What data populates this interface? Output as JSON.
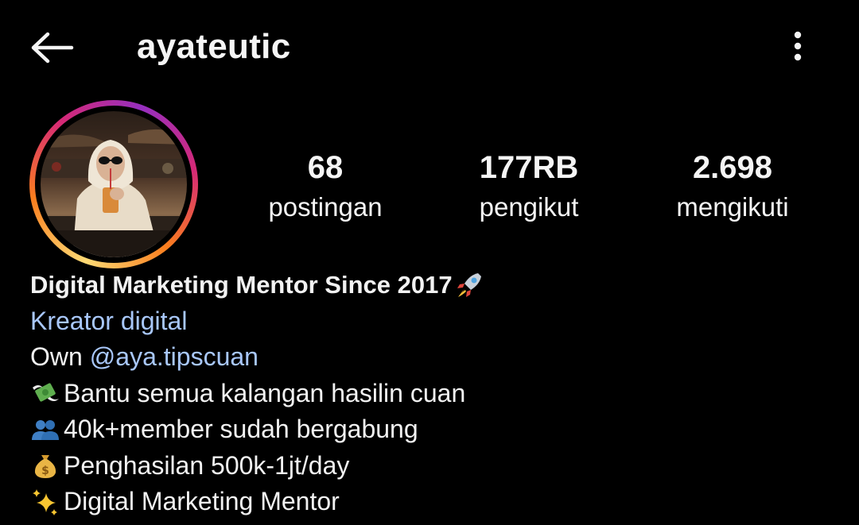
{
  "header": {
    "username": "ayateutic",
    "back_icon": "arrow-left-icon",
    "menu_icon": "more-vertical-icon"
  },
  "profile": {
    "avatar_icon": "profile-photo",
    "ring_colors": [
      "#feda75",
      "#fa7e1e",
      "#d62976",
      "#962fbf"
    ]
  },
  "stats": [
    {
      "value": "68",
      "label": "postingan"
    },
    {
      "value": "177RB",
      "label": "pengikut"
    },
    {
      "value": "2.698",
      "label": "mengikuti"
    }
  ],
  "bio": {
    "name": "Digital Marketing Mentor Since 2017",
    "name_emoji": "rocket-icon",
    "category": "Kreator digital",
    "own_prefix": "Own",
    "mention": "@aya.tipscuan",
    "lines": [
      {
        "emoji": "money-with-wings-icon",
        "text": "Bantu semua kalangan hasilin cuan"
      },
      {
        "emoji": "busts-in-silhouette-icon",
        "text": "40k+member sudah bergabung"
      },
      {
        "emoji": "money-bag-icon",
        "text": "Penghasilan 500k-1jt/day"
      },
      {
        "emoji": "sparkles-icon",
        "text": "Digital Marketing Mentor"
      }
    ]
  },
  "colors": {
    "background": "#000000",
    "text": "#f5f5f5",
    "link": "#a8c7fa"
  }
}
